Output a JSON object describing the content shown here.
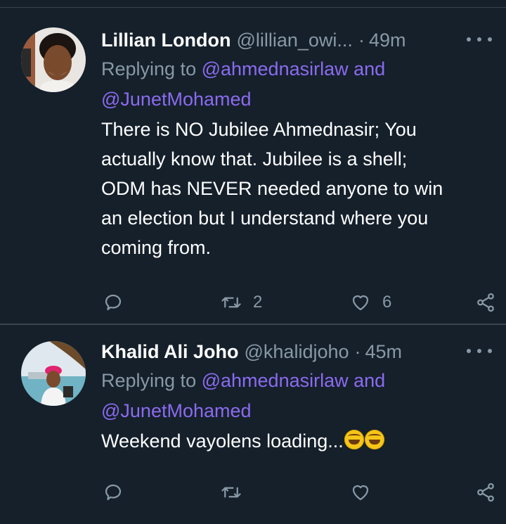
{
  "tweets": [
    {
      "name": "Lillian London",
      "handle": "@lillian_owi...",
      "separator": "·",
      "time": "49m",
      "replying_prefix": "Replying to",
      "mention_1": "@ahmednasirlaw",
      "mention_joiner": "and",
      "mention_2": "@JunetMohamed",
      "text_lines": [
        "There is NO Jubilee Ahmednasir; You",
        "actually know that. Jubilee is a shell;",
        "ODM has NEVER needed anyone to win",
        "an election but I understand where you",
        "coming from."
      ],
      "retweets": "2",
      "likes": "6"
    },
    {
      "name": "Khalid Ali Joho",
      "handle": "@khalidjoho",
      "separator": "·",
      "time": "45m",
      "replying_prefix": "Replying to",
      "mention_1": "@ahmednasirlaw",
      "mention_joiner": "and",
      "mention_2": "@JunetMohamed",
      "text": "Weekend vayolens loading...",
      "emoji": [
        "rolling-on-floor-laughing",
        "rolling-on-floor-laughing"
      ],
      "retweets": "",
      "likes": ""
    }
  ],
  "colors": {
    "background": "#15202b",
    "divider": "#38444d",
    "secondary_text": "#8899a6",
    "mention": "#8b6bf0"
  }
}
